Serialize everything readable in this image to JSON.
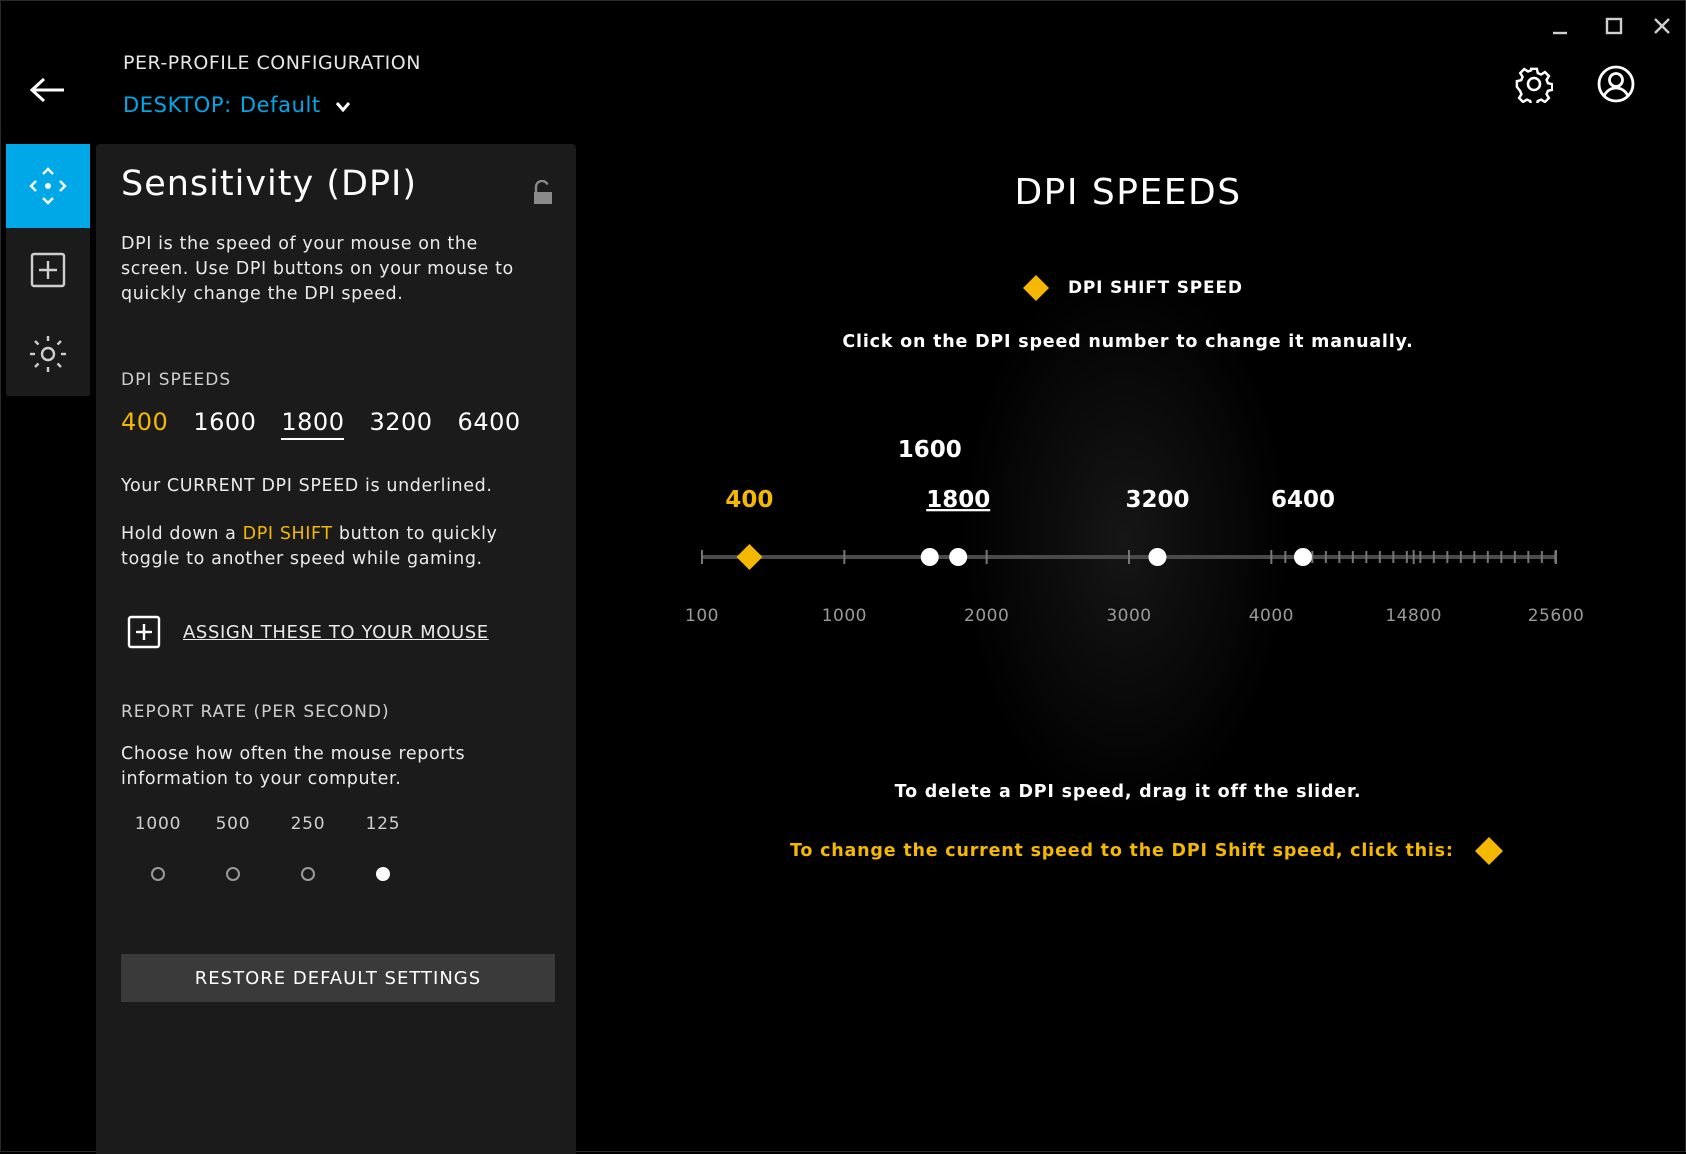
{
  "window": {
    "controls": [
      {
        "name": "minimize-button",
        "icon": "minimize-icon"
      },
      {
        "name": "maximize-button",
        "icon": "maximize-icon"
      },
      {
        "name": "close-button",
        "icon": "close-icon"
      }
    ]
  },
  "header": {
    "back_icon": "arrow-left-icon",
    "section_label": "PER-PROFILE CONFIGURATION",
    "profile_device": "DESKTOP:",
    "profile_name": "Default",
    "settings_icon": "gear-icon",
    "account_icon": "user-circle-icon"
  },
  "nav": {
    "items": [
      {
        "name": "sensitivity",
        "icon": "move-arrows-icon",
        "active": true
      },
      {
        "name": "assignments",
        "icon": "plus-square-icon",
        "active": false
      },
      {
        "name": "lighting",
        "icon": "sun-icon",
        "active": false
      }
    ]
  },
  "panel": {
    "title": "Sensitivity (DPI)",
    "lock_icon": "unlock-icon",
    "description": "DPI is the speed of your mouse on the screen. Use DPI buttons on your mouse to quickly change the DPI speed.",
    "dpi_label": "DPI SPEEDS",
    "dpi_speeds": [
      "400",
      "1600",
      "1800",
      "3200",
      "6400"
    ],
    "shift_dpi": "400",
    "current_dpi": "1800",
    "current_note": "Your CURRENT DPI SPEED is underlined.",
    "shift_note_pre": "Hold down a ",
    "shift_note_hl": "DPI SHIFT",
    "shift_note_post": " button to quickly toggle to another speed while gaming.",
    "assign_label": "ASSIGN THESE TO YOUR MOUSE",
    "report_label": "REPORT RATE (PER SECOND)",
    "report_desc": "Choose how often the mouse reports information to your computer.",
    "report_rates": [
      "1000",
      "500",
      "250",
      "125"
    ],
    "report_selected": "125",
    "restore_label": "RESTORE DEFAULT SETTINGS"
  },
  "main": {
    "title": "DPI SPEEDS",
    "shift_legend": "DPI SHIFT SPEED",
    "hint_manual": "Click on the DPI speed number to change it manually.",
    "hint_delete": "To delete a DPI speed, drag it off the slider.",
    "hint_shift": "To change the current speed to the DPI Shift speed, click this:",
    "slider": {
      "axis_labels": [
        "100",
        "1000",
        "2000",
        "3000",
        "4000",
        "14800",
        "25600"
      ],
      "markers": [
        {
          "dpi": "400",
          "type": "shift"
        },
        {
          "dpi": "1600",
          "type": "speed"
        },
        {
          "dpi": "1800",
          "type": "current"
        },
        {
          "dpi": "3200",
          "type": "speed"
        },
        {
          "dpi": "6400",
          "type": "speed"
        }
      ]
    }
  },
  "colors": {
    "accent_blue": "#00a8e8",
    "shift_yellow": "#f5b800",
    "panel_bg": "#1b1b1b",
    "button_bg": "#3a3a3a"
  }
}
